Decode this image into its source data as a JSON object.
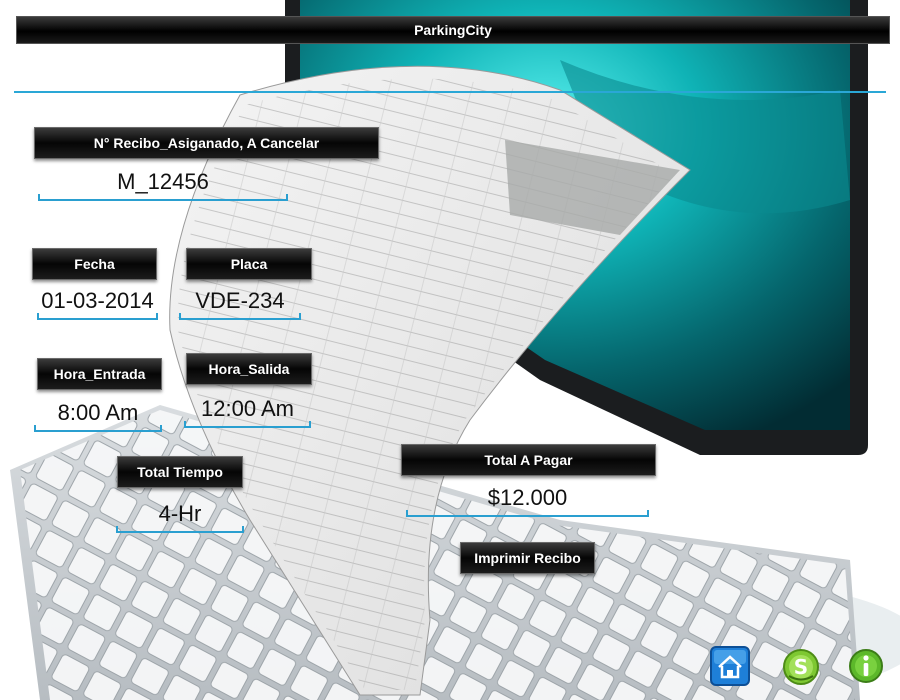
{
  "app": {
    "title": "ParkingCity"
  },
  "receipt": {
    "number_label": "N° Recibo_Asiganado, A Cancelar",
    "number_value": "M_12456",
    "date_label": "Fecha",
    "date_value": "01-03-2014",
    "plate_label": "Placa",
    "plate_value": "VDE-234",
    "entry_label": "Hora_Entrada",
    "entry_value": "8:00 Am",
    "exit_label": "Hora_Salida",
    "exit_value": "12:00 Am",
    "time_label": "Total Tiempo",
    "time_value": "4-Hr",
    "total_label": "Total A Pagar",
    "total_value": "$12.000"
  },
  "actions": {
    "print_label": "Imprimir Recibo"
  },
  "icons": {
    "home": "home-icon",
    "skype": "skype-icon",
    "info": "info-icon"
  },
  "colors": {
    "accent": "#2aa7d6",
    "label_bg": "#111111",
    "label_text": "#ffffff"
  }
}
